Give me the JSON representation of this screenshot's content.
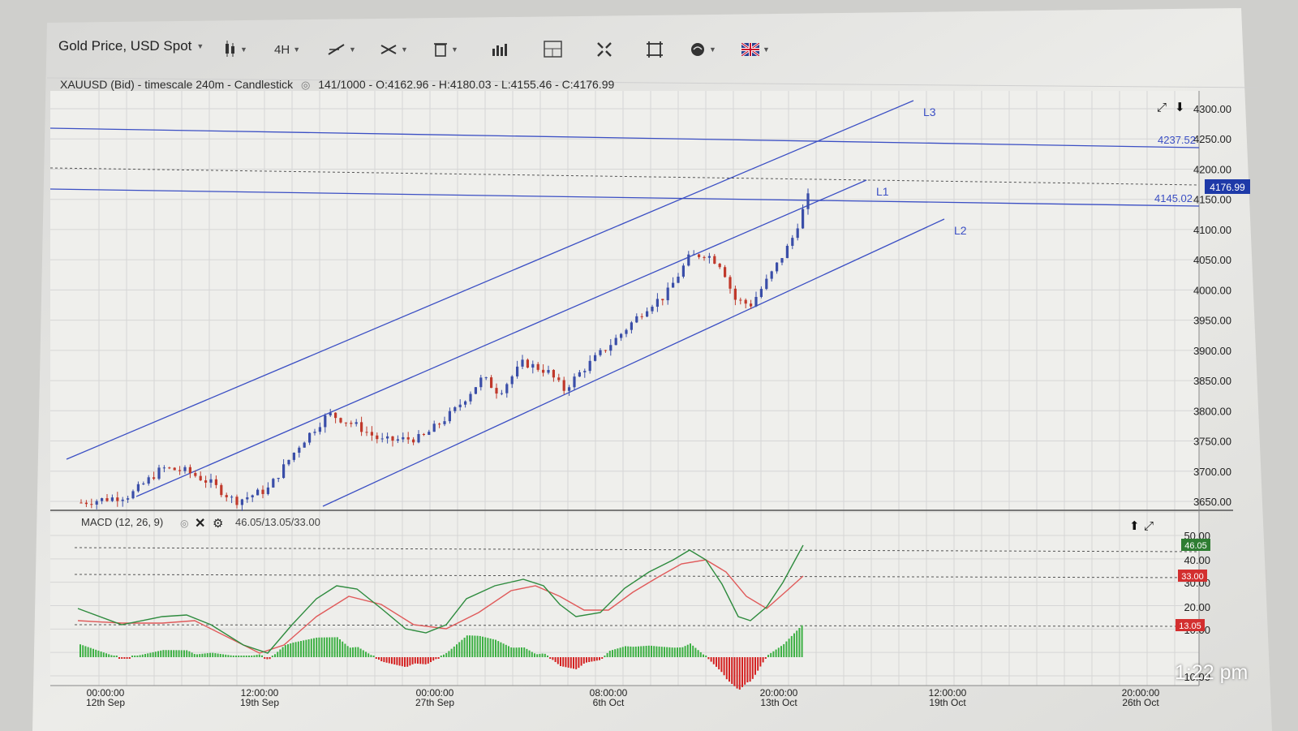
{
  "toolbar": {
    "instrument": "Gold Price, USD Spot",
    "timeframe": "4H",
    "icons": [
      "candlestick-icon",
      "timeframe",
      "line-tool-icon",
      "crosshair-icon",
      "delete-icon",
      "bar-chart-icon",
      "layout-icon",
      "fullscreen-icon",
      "crop-icon",
      "indicator-icon",
      "language-flag-icon"
    ]
  },
  "main_chart": {
    "symbol_text": "XAUUSD (Bid) - timescale 240m - Candlestick",
    "count": "141/1000",
    "ohlc": "- O:4162.96 - H:4180.03 - L:4155.46 - C:4176.99",
    "y_ticks": [
      "4300.00",
      "4250.00",
      "4200.00",
      "4150.00",
      "4100.00",
      "4050.00",
      "4000.00",
      "3950.00",
      "3900.00",
      "3850.00",
      "3800.00",
      "3750.00",
      "3700.00",
      "3650.00"
    ],
    "current_price": "4176.99",
    "level_labels": {
      "upper": "4237.52",
      "lower": "4145.02"
    },
    "line_labels": [
      "L3",
      "L1",
      "L2"
    ],
    "colors": {
      "up": "#3a4ea8",
      "down": "#c0392b",
      "line": "#3b4fc4",
      "grid": "#d6d6d6"
    }
  },
  "macd": {
    "title": "MACD (12, 26, 9)",
    "values": "46.05/13.05/33.00",
    "y_ticks": [
      "50.00",
      "40.00",
      "30.00",
      "20.00",
      "10.00",
      "-10.00"
    ],
    "badges": {
      "macd": "46.05",
      "signal": "33.00",
      "hist": "13.05"
    },
    "colors": {
      "macd": "#2e8b3e",
      "signal": "#e05a5a",
      "hist_pos": "#3cb043",
      "hist_neg": "#d42020"
    }
  },
  "x_axis": [
    {
      "time": "00:00:00",
      "date": "12th Sep"
    },
    {
      "time": "12:00:00",
      "date": "19th Sep"
    },
    {
      "time": "00:00:00",
      "date": "27th Sep"
    },
    {
      "time": "08:00:00",
      "date": "6th Oct"
    },
    {
      "time": "20:00:00",
      "date": "13th Oct"
    },
    {
      "time": "12:00:00",
      "date": "19th Oct"
    },
    {
      "time": "20:00:00",
      "date": "26th Oct"
    }
  ],
  "status_time": "1:22 pm"
}
